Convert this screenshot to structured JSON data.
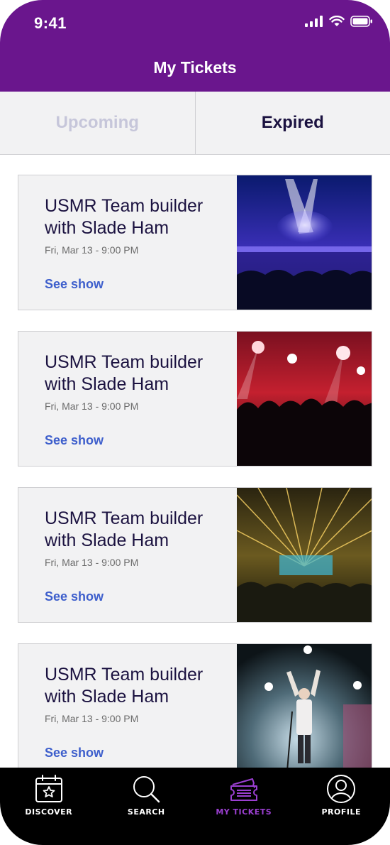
{
  "status_bar": {
    "time": "9:41"
  },
  "header": {
    "title": "My Tickets"
  },
  "tabs": [
    {
      "label": "Upcoming",
      "active": false
    },
    {
      "label": "Expired",
      "active": true
    }
  ],
  "tickets": [
    {
      "title": "USMR Team builder with Slade Ham",
      "date": "Fri, Mar 13 - 9:00 PM",
      "link": "See show",
      "image": "concert-spotlights"
    },
    {
      "title": "USMR Team builder with Slade Ham",
      "date": "Fri, Mar 13 - 9:00 PM",
      "link": "See show",
      "image": "concert-red-lights-crowd"
    },
    {
      "title": "USMR Team builder with Slade Ham",
      "date": "Fri, Mar 13 - 9:00 PM",
      "link": "See show",
      "image": "concert-laser-show"
    },
    {
      "title": "USMR Team builder with Slade Ham",
      "date": "Fri, Mar 13 - 9:00 PM",
      "link": "See show",
      "image": "concert-performer-smoke"
    }
  ],
  "bottom_nav": [
    {
      "label": "DISCOVER",
      "icon": "calendar-star-icon",
      "active": false
    },
    {
      "label": "SEARCH",
      "icon": "search-icon",
      "active": false
    },
    {
      "label": "MY TICKETS",
      "icon": "ticket-icon",
      "active": true
    },
    {
      "label": "PROFILE",
      "icon": "profile-icon",
      "active": false
    }
  ],
  "colors": {
    "header": "#6a168d",
    "tab_inactive": "#c6c6da",
    "tab_active": "#1b1240",
    "link": "#3e5fcc",
    "nav_active": "#9b3fd1"
  }
}
